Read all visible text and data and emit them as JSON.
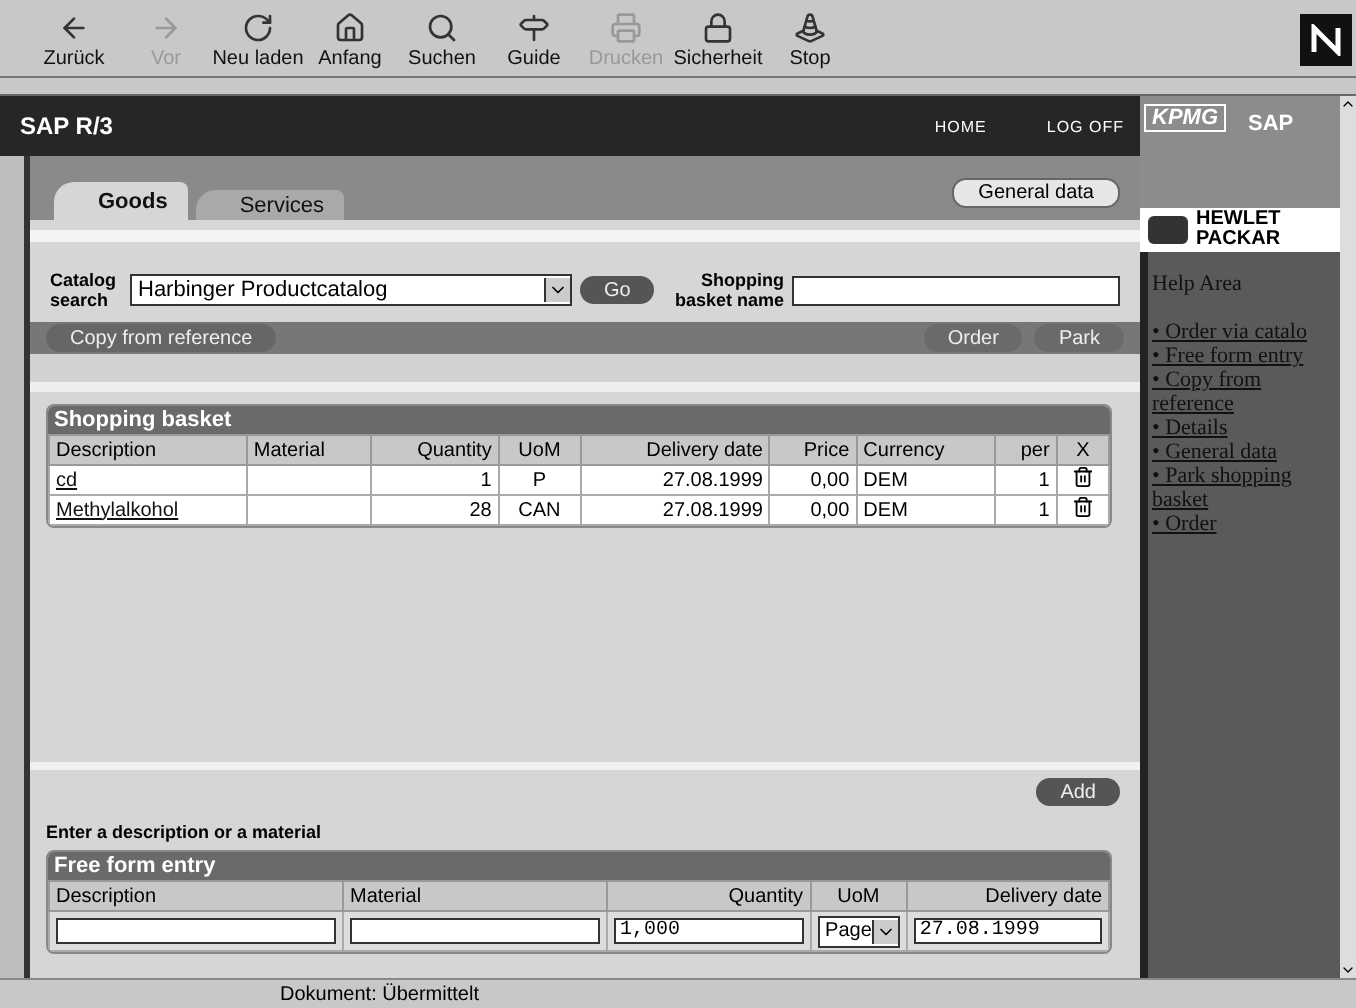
{
  "toolbar": [
    {
      "label": "Zurück",
      "disabled": false
    },
    {
      "label": "Vor",
      "disabled": true
    },
    {
      "label": "Neu laden",
      "disabled": false
    },
    {
      "label": "Anfang",
      "disabled": false
    },
    {
      "label": "Suchen",
      "disabled": false
    },
    {
      "label": "Guide",
      "disabled": false
    },
    {
      "label": "Drucken",
      "disabled": true
    },
    {
      "label": "Sicherheit",
      "disabled": false
    },
    {
      "label": "Stop",
      "disabled": false
    }
  ],
  "header": {
    "title": "SAP R/3",
    "links": [
      "HOME",
      "LOG OFF"
    ],
    "logo": "KPMG",
    "brand": "SAP"
  },
  "tabs": [
    {
      "label": "Goods",
      "selected": true
    },
    {
      "label": "Services",
      "selected": false
    }
  ],
  "general_button": "General data",
  "catalog": {
    "label": "Catalog search",
    "value": "Harbinger Productcatalog",
    "go": "Go",
    "basket_label": "Shopping basket name"
  },
  "copy_button": "Copy from reference",
  "actions": [
    "Order",
    "Park"
  ],
  "basket": {
    "title": "Shopping basket",
    "columns": [
      "Description",
      "Material",
      "Quantity",
      "UoM",
      "Delivery date",
      "Price",
      "Currency",
      "per",
      "X"
    ],
    "rows": [
      {
        "description": "cd",
        "material": "",
        "quantity": "1",
        "uom": "P",
        "date": "27.08.1999",
        "price": "0,00",
        "currency": "DEM",
        "per": "1"
      },
      {
        "description": "Methylalkohol",
        "material": "",
        "quantity": "28",
        "uom": "CAN",
        "date": "27.08.1999",
        "price": "0,00",
        "currency": "DEM",
        "per": "1"
      }
    ]
  },
  "add_button": "Add",
  "hint": "Enter a description or a material",
  "free_form": {
    "title": "Free form entry",
    "columns": [
      "Description",
      "Material",
      "Quantity",
      "UoM",
      "Delivery date"
    ],
    "quantity": "1,000",
    "uom": "Page",
    "date": "27.08.1999"
  },
  "hp_logo": [
    "HEWLET",
    "PACKAR"
  ],
  "help": {
    "title": "Help Area",
    "items": [
      {
        "bullet": "•",
        "label": "Order via catalo"
      },
      {
        "bullet": "•",
        "label": "Free form entry"
      },
      {
        "bullet": "•",
        "label": "Copy from reference"
      },
      {
        "bullet": "•",
        "label": "Details"
      },
      {
        "bullet": "•",
        "label": "General data"
      },
      {
        "bullet": "•",
        "label": "Park shopping basket"
      },
      {
        "bullet": "•",
        "label": "Order"
      }
    ]
  },
  "status": "Dokument: Übermittelt"
}
